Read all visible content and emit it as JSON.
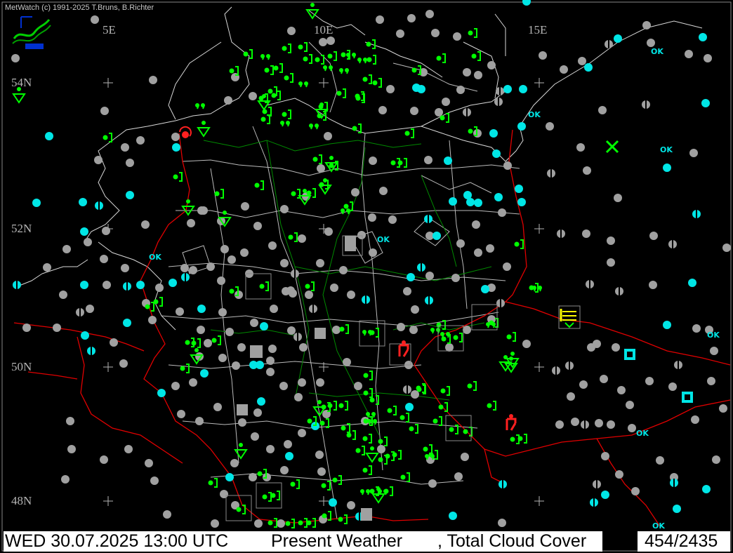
{
  "app": {
    "credit": "MetWatch (c) 1991-2025 T.Bruns, B.Richter"
  },
  "map": {
    "longitude_labels": [
      "5E",
      "10E",
      "15E"
    ],
    "latitude_labels": [
      "54N",
      "52N",
      "50N",
      "48N"
    ],
    "ok_label": "OK",
    "colors": {
      "background": "#000000",
      "coastline": "#ffffff",
      "border": "#e00000",
      "state_border": "#00aa00",
      "cloud_symbol": "#a0a0a0",
      "cloud_few": "#00e6e6",
      "rain_symbol": "#00ff00",
      "thunder_symbol": "#ff2020",
      "fog_symbol": "#ffff00"
    },
    "legend_symbols": [
      "rain-dots",
      "drizzle",
      "showers",
      "thunderstorm",
      "fog",
      "cloud-cover-circle",
      "ok-clear"
    ]
  },
  "status": {
    "datetime": "WED 30.07.2025 13:00 UTC",
    "product": "Present Weather",
    "second_product": ", Total Cloud Cover",
    "count": "454/2435"
  }
}
